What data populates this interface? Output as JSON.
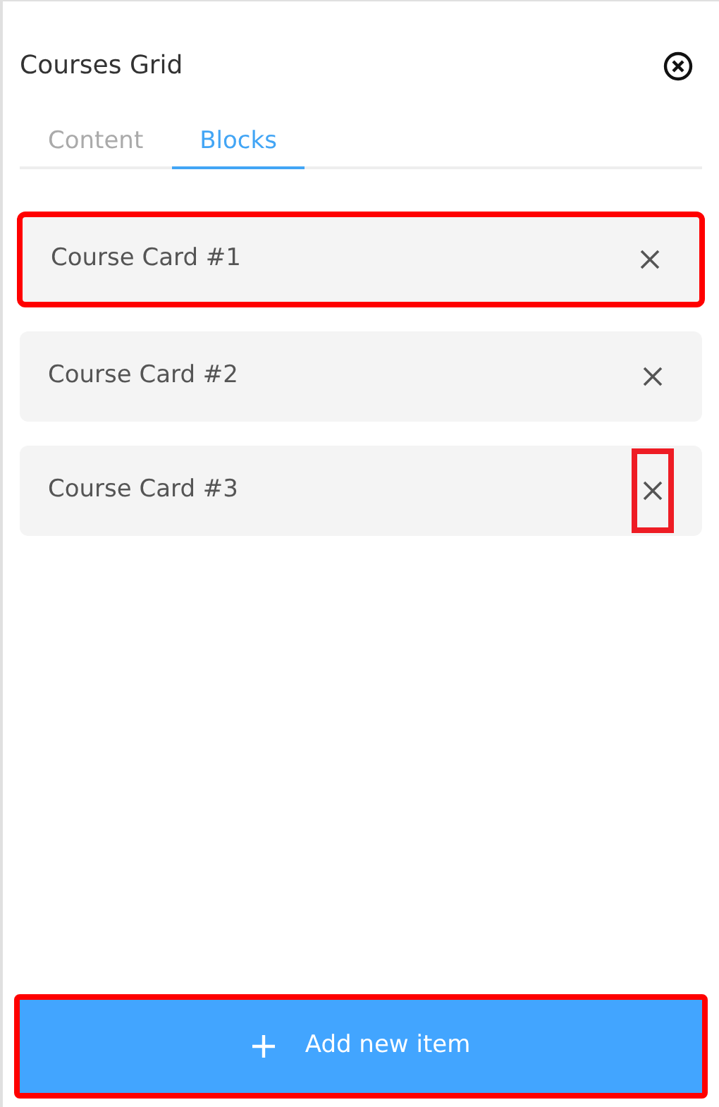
{
  "panel": {
    "title": "Courses Grid"
  },
  "tabs": [
    {
      "label": "Content",
      "selected": false
    },
    {
      "label": "Blocks",
      "selected": true
    }
  ],
  "items": [
    {
      "label": "Course Card #1",
      "highlighted": true,
      "remove_highlighted": false
    },
    {
      "label": "Course Card #2",
      "highlighted": false,
      "remove_highlighted": false
    },
    {
      "label": "Course Card #3",
      "highlighted": false,
      "remove_highlighted": true
    }
  ],
  "add_button": {
    "label": "Add new item",
    "highlighted": true
  }
}
